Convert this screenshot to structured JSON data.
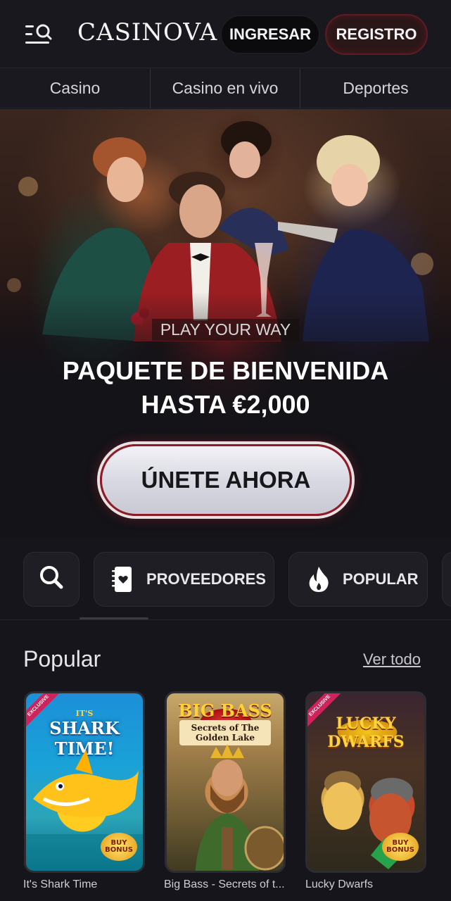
{
  "header": {
    "logo": "CASINOVA",
    "login_label": "INGRESAR",
    "register_label": "REGISTRO",
    "menu_icon": "menu-search-icon"
  },
  "nav": {
    "items": [
      {
        "label": "Casino"
      },
      {
        "label": "Casino en vivo"
      },
      {
        "label": "Deportes"
      }
    ]
  },
  "hero": {
    "tagline": "PLAY YOUR WAY",
    "title_line1": "PAQUETE DE BIENVENIDA",
    "title_line2": "HASTA €2,000",
    "cta_label": "ÚNETE AHORA"
  },
  "filters": {
    "search_icon": "search-icon",
    "providers_label": "PROVEEDORES",
    "providers_icon": "notebook-heart-icon",
    "popular_label": "POPULAR",
    "popular_icon": "flame-icon"
  },
  "popular": {
    "title": "Popular",
    "view_all": "Ver todo",
    "games": [
      {
        "name": "It's Shark Time",
        "art_title": "SHARK TIME!",
        "art_small": "IT'S",
        "tag": "EXCLUSIVE",
        "badge": "BUY BONUS"
      },
      {
        "name": "Big Bass - Secrets of t...",
        "art_title": "BIG BASS",
        "art_sub": "Secrets of The Golden Lake"
      },
      {
        "name": "Lucky Dwarfs",
        "art_title": "LUCKY DWARFS",
        "tag": "EXCLUSIVE",
        "badge": "BUY BONUS"
      }
    ]
  },
  "colors": {
    "background": "#16151b",
    "accent_red": "#8e1b25",
    "cta_bg": "#e2e2ea"
  }
}
